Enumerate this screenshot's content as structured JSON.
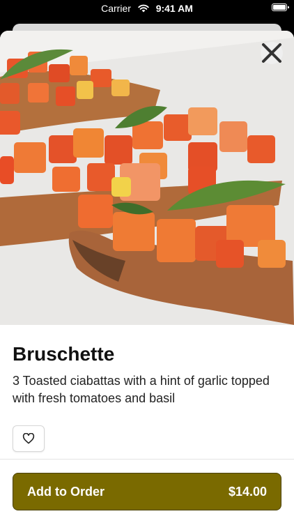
{
  "status_bar": {
    "carrier": "Carrier",
    "time": "9:41 AM"
  },
  "product": {
    "name": "Bruschette",
    "description": "3 Toasted ciabattas with a hint of garlic topped with fresh tomatoes and basil",
    "image_icon": "bruschetta-photo"
  },
  "actions": {
    "add_label": "Add to Order",
    "price": "$14.00",
    "favorite_icon": "heart-outline-icon",
    "close_icon": "close-icon"
  },
  "colors": {
    "accent": "#7a6a00",
    "accent_border": "#4a4000"
  }
}
